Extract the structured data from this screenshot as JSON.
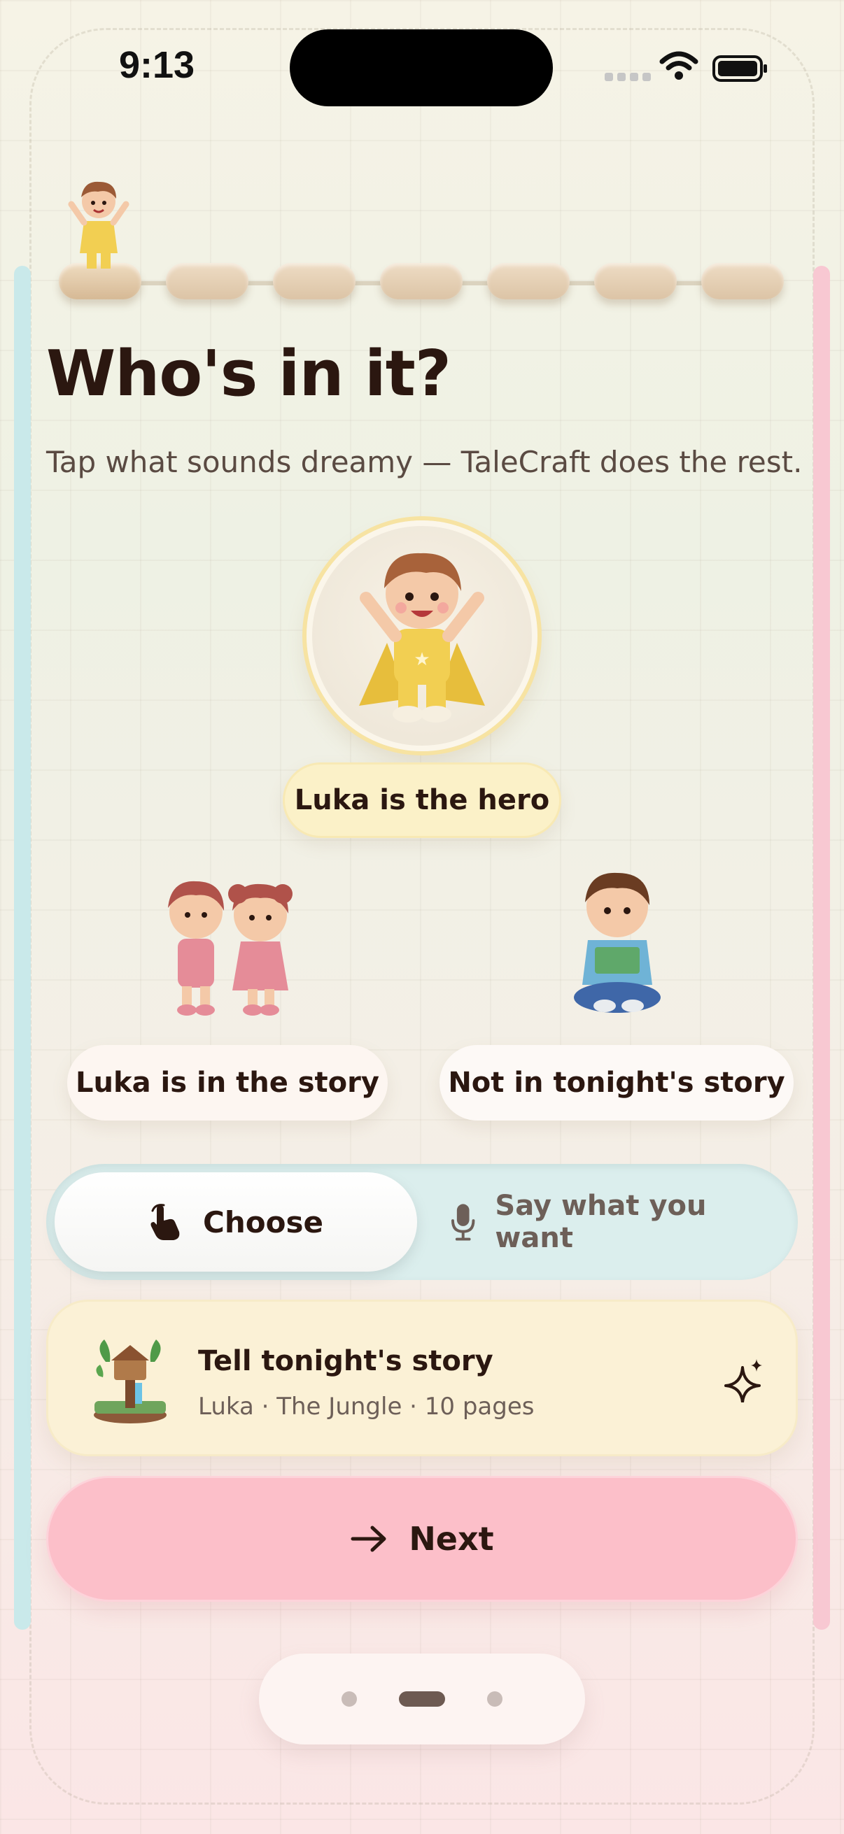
{
  "status_bar": {
    "time": "9:13"
  },
  "header": {
    "title": "Who's in it?",
    "subtitle": "Tap what sounds dreamy — TaleCraft does the rest."
  },
  "progress": {
    "total_steps": 7,
    "current_step": 1
  },
  "choices": {
    "hero_label": "Luka is the hero",
    "in_story_label": "Luka is in the story",
    "not_in_story_label": "Not in tonight's story"
  },
  "mode_toggle": {
    "choose_label": "Choose",
    "say_label": "Say what you want",
    "selected": "Choose"
  },
  "story_card": {
    "title": "Tell tonight's story",
    "meta": "Luka · The Jungle · 10 pages"
  },
  "next_button": {
    "label": "Next"
  },
  "pager": {
    "count": 3,
    "active_index": 1
  },
  "colors": {
    "accent_pink": "#fcbfc9",
    "accent_yellow": "#fbf1c8",
    "accent_teal": "#dbeeed",
    "text_dark": "#2b1710"
  },
  "icons": [
    "tap-hand-icon",
    "microphone-icon",
    "arrow-right-icon",
    "sparkle-icon",
    "wifi-icon",
    "battery-icon"
  ]
}
